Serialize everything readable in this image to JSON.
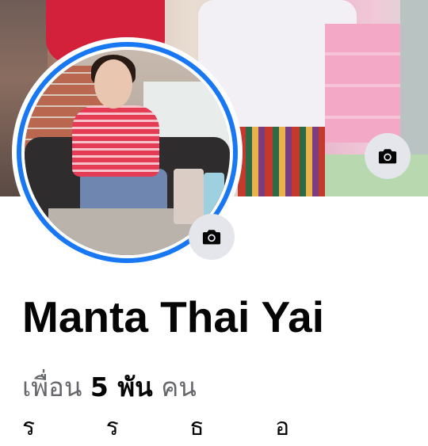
{
  "profile": {
    "name": "Manta Thai Yai",
    "friends_prefix": "เพื่อน",
    "friends_count": "5 พัน",
    "friends_suffix": "คน"
  },
  "partial_line": "ร ร ธ อ",
  "icons": {
    "cover_camera": "camera-icon",
    "avatar_camera": "camera-icon"
  },
  "colors": {
    "accent": "#1877f2",
    "camera_button_bg": "#e4e6eb",
    "secondary_text": "#65676b"
  }
}
